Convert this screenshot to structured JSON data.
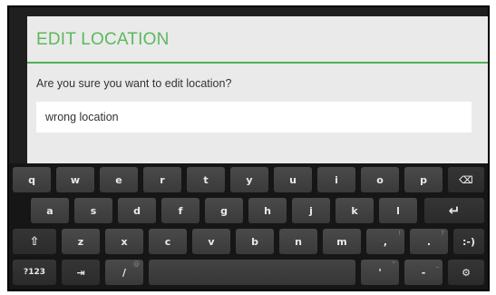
{
  "dialog": {
    "title": "EDIT LOCATION",
    "message": "Are you sure you want to edit location?",
    "input_value": "wrong location"
  },
  "keyboard": {
    "row1": [
      "q",
      "w",
      "e",
      "r",
      "t",
      "y",
      "u",
      "i",
      "o",
      "p"
    ],
    "row1_backspace": "⌫",
    "row2": [
      "a",
      "s",
      "d",
      "f",
      "g",
      "h",
      "j",
      "k",
      "l"
    ],
    "row2_enter": "↵",
    "row3_shift": "⇧",
    "row3": [
      "z",
      "x",
      "c",
      "v",
      "b",
      "n",
      "m"
    ],
    "row3_comma": ",",
    "row3_comma_hint": "!",
    "row3_period": ".",
    "row3_period_hint": "?",
    "row3_smiley": ":-)",
    "row4_symbols": "?123",
    "row4_tab": "⇥",
    "row4_slash": "/",
    "row4_slash_hint": "@",
    "row4_apostrophe": "'",
    "row4_apostrophe_hint": "\"",
    "row4_dash": "-",
    "row4_dash_hint": "_",
    "row4_settings": "⚙"
  },
  "colors": {
    "accent": "#5cb85c",
    "dialog_bg": "#eaeaea",
    "keyboard_bg": "#161616",
    "key_bg": "#424242"
  }
}
